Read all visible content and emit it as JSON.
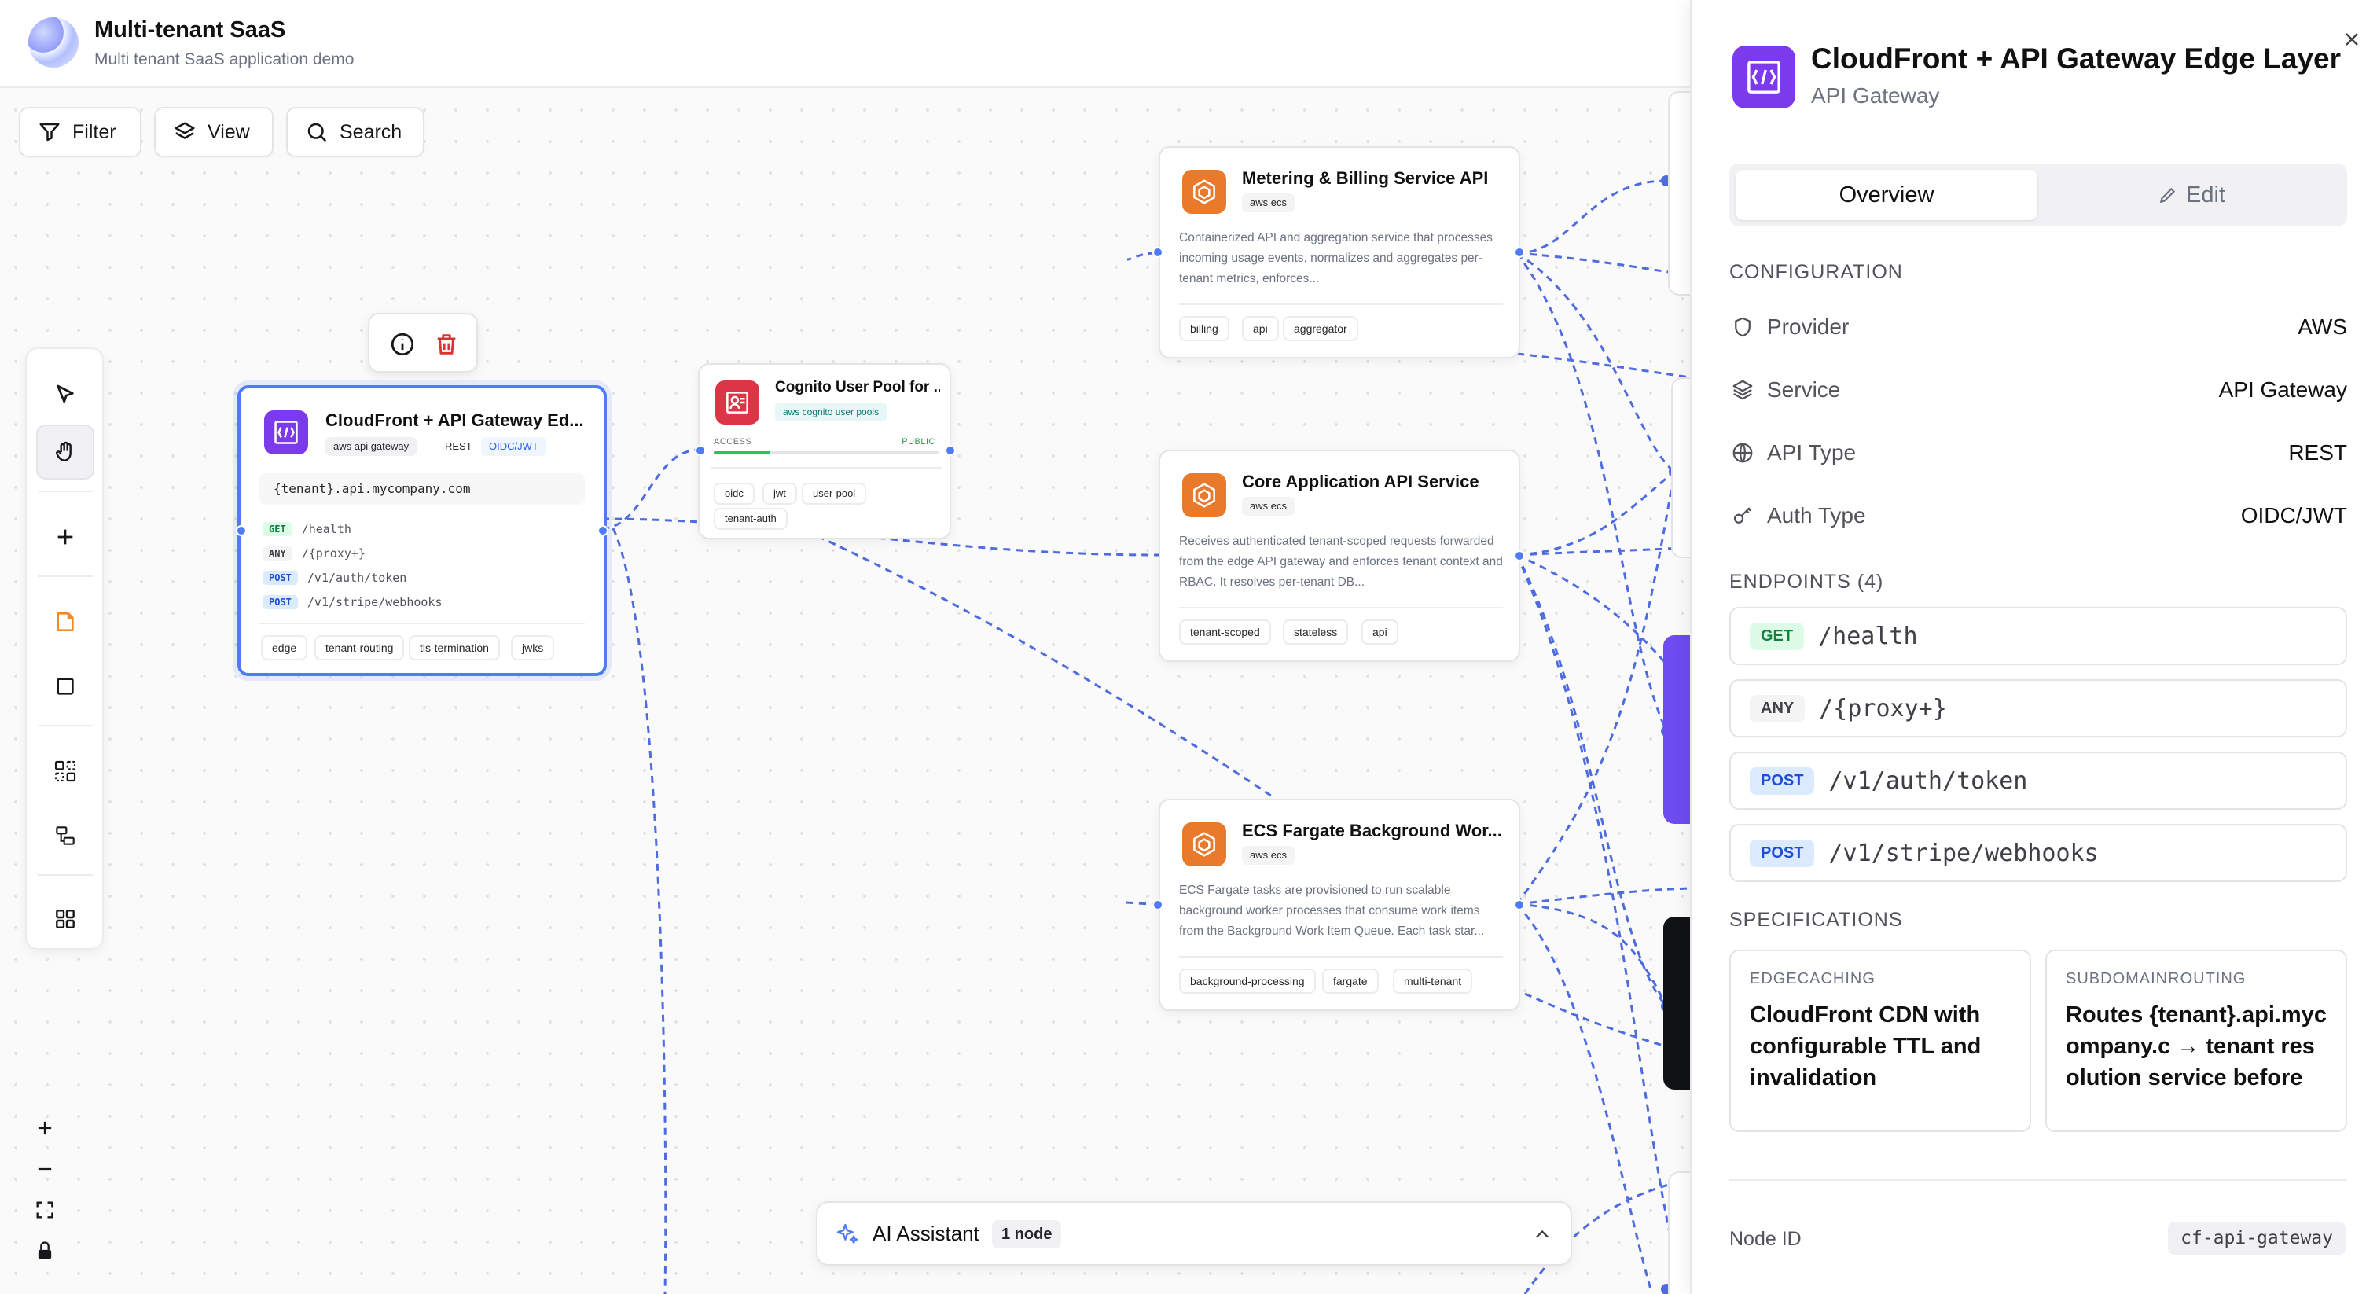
{
  "app": {
    "title": "Multi-tenant SaaS",
    "subtitle": "Multi tenant SaaS application demo"
  },
  "toolbar": {
    "filter": "Filter",
    "view": "View",
    "search": "Search"
  },
  "canvas": {
    "selected_node": {
      "title": "CloudFront + API Gateway Ed...",
      "chips": [
        "aws api gateway",
        "REST",
        "OIDC/JWT"
      ],
      "domain": "{tenant}.api.mycompany.com",
      "endpoints": [
        {
          "method": "GET",
          "path": "/health"
        },
        {
          "method": "ANY",
          "path": "/{proxy+}"
        },
        {
          "method": "POST",
          "path": "/v1/auth/token"
        },
        {
          "method": "POST",
          "path": "/v1/stripe/webhooks"
        }
      ],
      "tags": [
        "edge",
        "tenant-routing",
        "tls-termination",
        "jwks"
      ]
    },
    "cognito_node": {
      "title": "Cognito User Pool for ...",
      "chip": "aws cognito user pools",
      "access_label": "ACCESS",
      "access_value": "PUBLIC",
      "access_level": 0.25,
      "tags": [
        "oidc",
        "jwt",
        "user-pool",
        "tenant-auth"
      ]
    },
    "metering_node": {
      "title": "Metering & Billing Service API",
      "chip": "aws ecs",
      "desc": "Containerized API and aggregation service that processes incoming usage events, normalizes and aggregates per-tenant metrics, enforces...",
      "tags": [
        "billing",
        "api",
        "aggregator"
      ]
    },
    "core_node": {
      "title": "Core Application API Service",
      "chip": "aws ecs",
      "desc": "Receives authenticated tenant-scoped requests forwarded from the edge API gateway and enforces tenant context and RBAC. It resolves per-tenant DB...",
      "tags": [
        "tenant-scoped",
        "stateless",
        "api"
      ]
    },
    "ecs_node": {
      "title": "ECS Fargate Background Wor...",
      "chip": "aws ecs",
      "desc": "ECS Fargate tasks are provisioned to run scalable background worker processes that consume work items from the Background Work Item Queue. Each task star...",
      "tags": [
        "background-processing",
        "fargate",
        "multi-tenant"
      ]
    }
  },
  "ai_assistant": {
    "label": "AI Assistant",
    "badge": "1 node"
  },
  "panel": {
    "title": "CloudFront + API Gateway Edge Layer",
    "subtitle": "API Gateway",
    "tabs": {
      "overview": "Overview",
      "edit": "Edit"
    },
    "configuration_heading": "CONFIGURATION",
    "config": [
      {
        "key": "Provider",
        "value": "AWS",
        "icon": "shield-icon"
      },
      {
        "key": "Service",
        "value": "API Gateway",
        "icon": "layers-icon"
      },
      {
        "key": "API Type",
        "value": "REST",
        "icon": "globe-icon"
      },
      {
        "key": "Auth Type",
        "value": "OIDC/JWT",
        "icon": "key-icon"
      }
    ],
    "endpoints_heading": "ENDPOINTS (4)",
    "endpoints": [
      {
        "method": "GET",
        "path": "/health"
      },
      {
        "method": "ANY",
        "path": "/{proxy+}"
      },
      {
        "method": "POST",
        "path": "/v1/auth/token"
      },
      {
        "method": "POST",
        "path": "/v1/stripe/webhooks"
      }
    ],
    "specifications_heading": "SPECIFICATIONS",
    "specs": [
      {
        "key": "EDGECACHING",
        "value": "CloudFront CDN with configurable TTL and invalidation"
      },
      {
        "key": "SUBDOMAINROUTING",
        "value": "Routes {tenant}.api.mycompany.c → tenant resolution service before"
      }
    ],
    "node_id_label": "Node ID",
    "node_id": "cf-api-gateway"
  },
  "colors": {
    "accent": "#4f7cf6",
    "api_gateway": "#7c3aed",
    "ecs": "#ea7a2b",
    "cognito": "#dc3545"
  }
}
